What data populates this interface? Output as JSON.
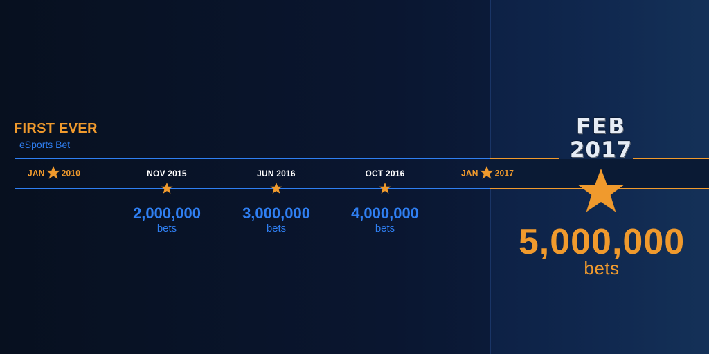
{
  "intro": {
    "title": "FIRST EVER",
    "subtitle": "eSports Bet"
  },
  "milestones": [
    {
      "date": "NOV 2015",
      "count": "2,000,000",
      "unit": "bets"
    },
    {
      "date": "JUN 2016",
      "count": "3,000,000",
      "unit": "bets"
    },
    {
      "date": "OCT 2016",
      "count": "4,000,000",
      "unit": "bets"
    }
  ],
  "range_start": {
    "month": "JAN",
    "year": "2010"
  },
  "range_end": {
    "month": "JAN",
    "year": "2017"
  },
  "highlight": {
    "month": "FEB",
    "year": "2017",
    "count": "5,000,000",
    "unit": "bets"
  },
  "colors": {
    "accent_blue": "#2f7ff2",
    "accent_orange": "#f09a2d",
    "background": "#0a1428"
  },
  "icons": {
    "marker": "star-icon"
  }
}
